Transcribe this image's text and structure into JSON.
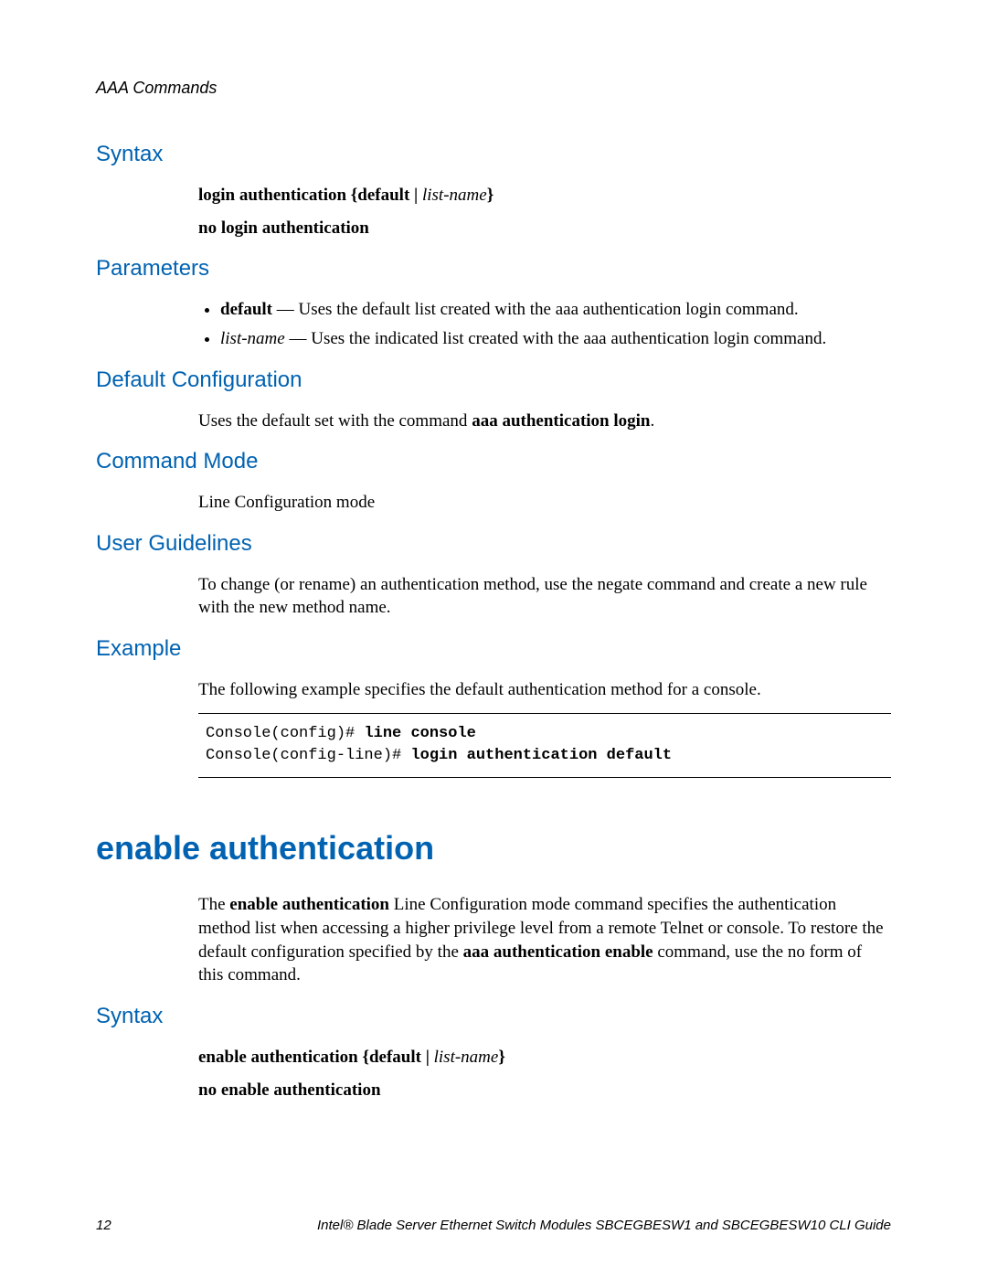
{
  "running_head": "AAA Commands",
  "section1": {
    "syntax_heading": "Syntax",
    "syntax_line1_prefix": "login authentication {default | ",
    "syntax_line1_italic": "list-name",
    "syntax_line1_suffix": "}",
    "syntax_line2": "no login authentication",
    "parameters_heading": "Parameters",
    "param1_term": "default",
    "param1_desc": " — Uses the default list created with the aaa authentication login command.",
    "param2_term": "list-name",
    "param2_desc": " — Uses the indicated list created with the aaa authentication login command.",
    "default_config_heading": "Default Configuration",
    "default_config_text_pre": "Uses the default set with the command ",
    "default_config_text_bold": "aaa authentication login",
    "default_config_text_post": ".",
    "command_mode_heading": "Command Mode",
    "command_mode_text": "Line Configuration mode",
    "user_guidelines_heading": "User Guidelines",
    "user_guidelines_text": "To change (or rename) an authentication method, use the negate command and create a new rule with the new method name.",
    "example_heading": "Example",
    "example_intro": "The following example specifies the default authentication method for a console.",
    "example_code_line1_pre": "Console(config)# ",
    "example_code_line1_bold": "line console",
    "example_code_line2_pre": "Console(config-line)# ",
    "example_code_line2_bold": "login authentication default"
  },
  "section2": {
    "title": "enable authentication",
    "intro_pre": "The ",
    "intro_bold1": "enable authentication",
    "intro_mid": " Line Configuration mode command specifies the authentication method list when accessing a higher privilege level from a remote Telnet or console. To restore the default configuration specified by the ",
    "intro_bold2": "aaa authentication enable",
    "intro_post": " command, use the no form of this command.",
    "syntax_heading": "Syntax",
    "syntax_line1_prefix": "enable authentication {default | ",
    "syntax_line1_italic": "list-name",
    "syntax_line1_suffix": "}",
    "syntax_line2": "no enable authentication"
  },
  "footer": {
    "page_num": "12",
    "doc_title": "Intel® Blade Server Ethernet Switch Modules SBCEGBESW1 and SBCEGBESW10 CLI Guide"
  }
}
